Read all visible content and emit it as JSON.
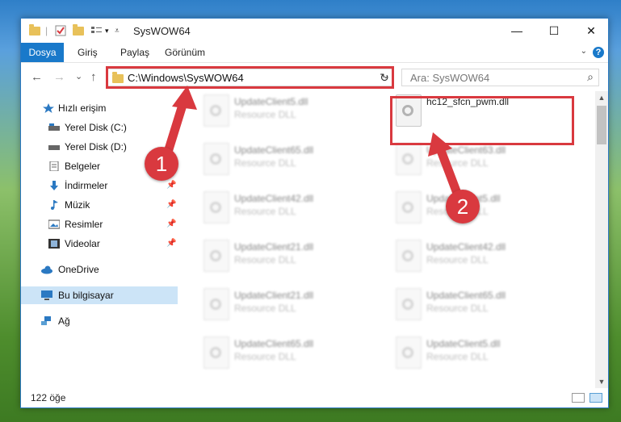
{
  "window": {
    "title": "SysWOW64",
    "controls": {
      "minimize": "—",
      "maximize": "☐",
      "close": "✕"
    }
  },
  "ribbon": {
    "tabs": [
      "Dosya",
      "Giriş",
      "Paylaş",
      "Görünüm"
    ],
    "help": "?"
  },
  "nav": {
    "back": "←",
    "forward": "→",
    "recent": "⌄",
    "up": "↑",
    "address": "C:\\Windows\\SysWOW64",
    "refresh": "↻",
    "search_placeholder": "Ara: SysWOW64"
  },
  "sidebar": {
    "items": [
      {
        "label": "Hızlı erişim",
        "icon": "star-icon",
        "pinned": false
      },
      {
        "label": "Yerel Disk (C:)",
        "icon": "drive-icon",
        "pinned": false
      },
      {
        "label": "Yerel Disk (D:)",
        "icon": "drive-icon",
        "pinned": false
      },
      {
        "label": "Belgeler",
        "icon": "document-icon",
        "pinned": true
      },
      {
        "label": "İndirmeler",
        "icon": "download-icon",
        "pinned": true
      },
      {
        "label": "Müzik",
        "icon": "music-icon",
        "pinned": true
      },
      {
        "label": "Resimler",
        "icon": "pictures-icon",
        "pinned": true
      },
      {
        "label": "Videolar",
        "icon": "video-icon",
        "pinned": true
      },
      {
        "label": "OneDrive",
        "icon": "cloud-icon",
        "pinned": false
      },
      {
        "label": "Bu bilgisayar",
        "icon": "computer-icon",
        "pinned": false
      },
      {
        "label": "Ağ",
        "icon": "network-icon",
        "pinned": false
      }
    ]
  },
  "files": [
    {
      "name": "UpdateClient5.dll",
      "type": "Resource DLL"
    },
    {
      "name": "hc12_sfcn_pwm.dll",
      "type": ""
    },
    {
      "name": "UpdateClient65.dll",
      "type": "Resource DLL"
    },
    {
      "name": "UpdateClient63.dll",
      "type": "Resource DLL"
    },
    {
      "name": "UpdateClient42.dll",
      "type": "Resource DLL"
    },
    {
      "name": "UpdateClient5.dll",
      "type": "Resource DLL"
    },
    {
      "name": "UpdateClient21.dll",
      "type": "Resource DLL"
    },
    {
      "name": "UpdateClient42.dll",
      "type": "Resource DLL"
    },
    {
      "name": "UpdateClient21.dll",
      "type": "Resource DLL"
    },
    {
      "name": "UpdateClient65.dll",
      "type": "Resource DLL"
    },
    {
      "name": "UpdateClient65.dll",
      "type": "Resource DLL"
    },
    {
      "name": "UpdateClient5.dll",
      "type": "Resource DLL"
    }
  ],
  "status": {
    "count": "122 öğe"
  },
  "annotations": {
    "badge1": "1",
    "badge2": "2",
    "color": "#d9393f"
  }
}
